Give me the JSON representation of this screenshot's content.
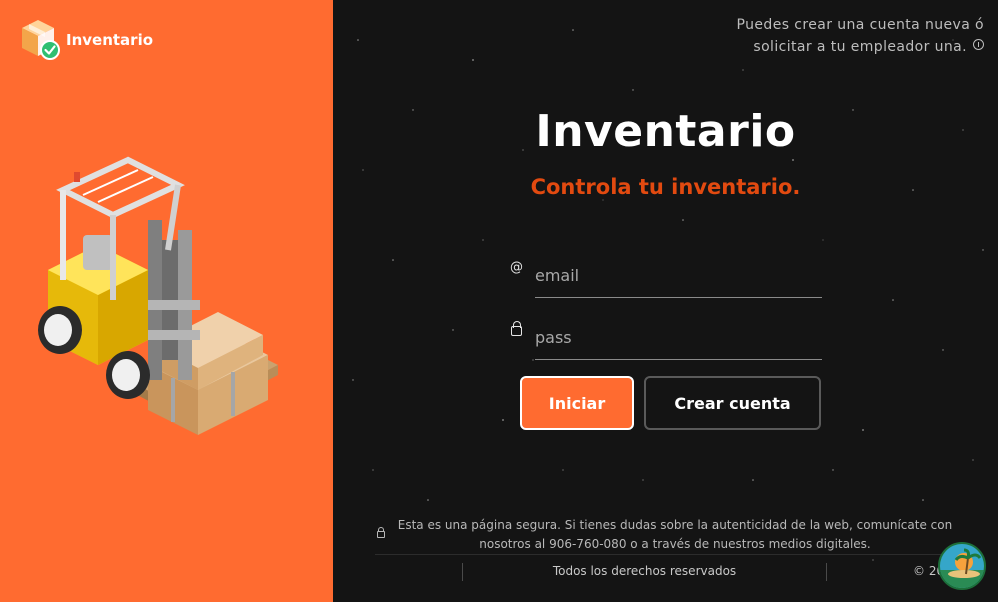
{
  "brand": {
    "name": "Inventario"
  },
  "header": {
    "note_line1": "Puedes crear una cuenta nueva ó",
    "note_line2": "solicitar a tu empleador una."
  },
  "main": {
    "title": "Inventario",
    "subtitle": "Controla tu inventario."
  },
  "form": {
    "email_placeholder": "email",
    "email_value": "",
    "pass_placeholder": "pass",
    "pass_value": "",
    "login_label": "Iniciar",
    "create_label": "Crear cuenta"
  },
  "footer": {
    "secure_line1": "Esta es una página segura. Si tienes dudas sobre la autenticidad de la web, comunícate con",
    "secure_line2": "nosotros al 906-760-080 o a través de nuestros medios digitales.",
    "rights": "Todos los derechos reservados",
    "copyright": "© 20"
  },
  "icons": {
    "brand": "box-check-icon",
    "info": "info-icon",
    "email": "at-icon",
    "pass": "lock-icon",
    "secure": "lock-icon",
    "avatar": "island-avatar-icon"
  },
  "colors": {
    "accent": "#ff6b30",
    "subtitle": "#e24a10",
    "background": "#141414"
  }
}
